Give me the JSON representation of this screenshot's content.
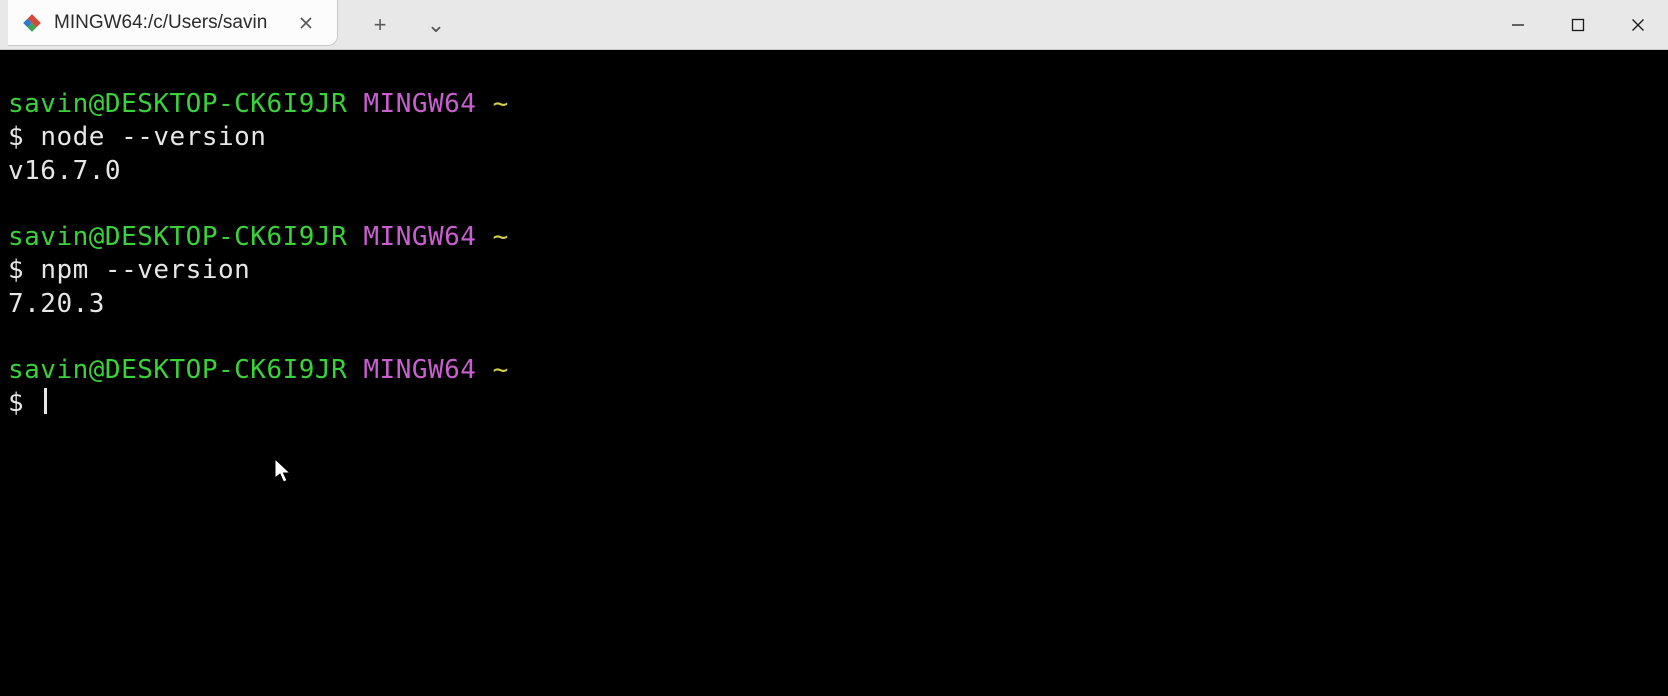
{
  "titlebar": {
    "tab": {
      "title": "MINGW64:/c/Users/savin",
      "icon": "git-bash-icon"
    },
    "actions": {
      "new_tab_glyph": "+",
      "dropdown_glyph": "⌄"
    }
  },
  "terminal": {
    "blocks": [
      {
        "user_host": "savin@DESKTOP-CK6I9JR",
        "env": "MINGW64",
        "path": "~",
        "prompt_symbol": "$",
        "command": "node --version",
        "output": "v16.7.0"
      },
      {
        "user_host": "savin@DESKTOP-CK6I9JR",
        "env": "MINGW64",
        "path": "~",
        "prompt_symbol": "$",
        "command": "npm --version",
        "output": "7.20.3"
      },
      {
        "user_host": "savin@DESKTOP-CK6I9JR",
        "env": "MINGW64",
        "path": "~",
        "prompt_symbol": "$",
        "command": "",
        "output": ""
      }
    ]
  },
  "colors": {
    "user_host": "#3bd13b",
    "env": "#c85fcf",
    "path": "#d6cf4a",
    "foreground": "#e6e6e6",
    "background": "#000000",
    "titlebar_bg": "#e8e8e8",
    "tab_bg": "#fcfcfc"
  }
}
